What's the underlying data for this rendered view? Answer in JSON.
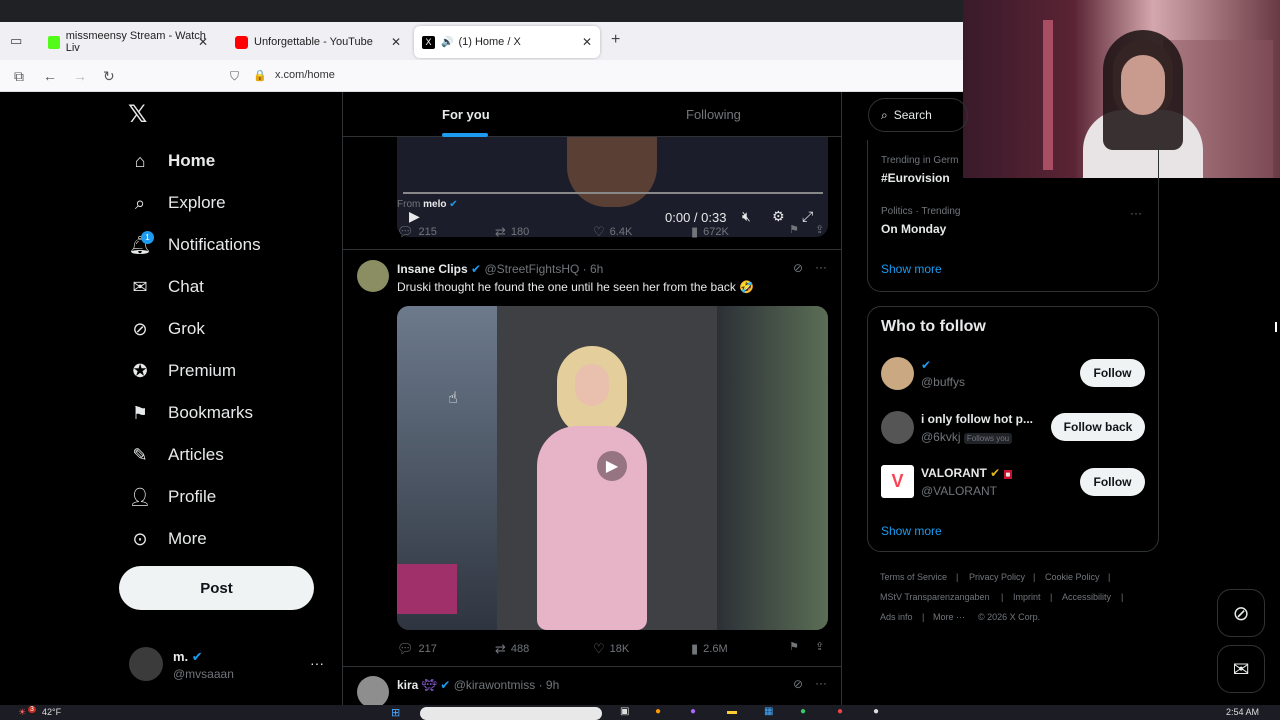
{
  "browser": {
    "tabs": [
      {
        "title": "missmeensy Stream - Watch Liv",
        "color": "#53fc18"
      },
      {
        "title": "Unforgettable - YouTube",
        "color": "#ff0000"
      },
      {
        "title": "(1) Home / X",
        "color": "#000000"
      }
    ],
    "url": "x.com/home"
  },
  "nav": {
    "items": [
      {
        "label": "Home",
        "icon": "home-icon"
      },
      {
        "label": "Explore",
        "icon": "search-icon"
      },
      {
        "label": "Notifications",
        "icon": "bell-icon",
        "badge": "1"
      },
      {
        "label": "Chat",
        "icon": "mail-icon"
      },
      {
        "label": "Grok",
        "icon": "grok-icon"
      },
      {
        "label": "Premium",
        "icon": "verified-icon"
      },
      {
        "label": "Bookmarks",
        "icon": "bookmark-icon"
      },
      {
        "label": "Articles",
        "icon": "article-icon"
      },
      {
        "label": "Profile",
        "icon": "person-icon"
      },
      {
        "label": "More",
        "icon": "more-icon"
      }
    ],
    "post_label": "Post",
    "account": {
      "name": "m.",
      "handle": "@mvsaaan"
    }
  },
  "feed": {
    "tabs": [
      "For you",
      "Following"
    ],
    "video1": {
      "time": "0:00 / 0:33",
      "from_label": "From",
      "from_name": "melo",
      "stats": {
        "replies": "215",
        "reposts": "180",
        "likes": "6.4K",
        "views": "672K"
      }
    },
    "post2": {
      "name": "Insane Clips",
      "handle": "@StreetFightsHQ",
      "age": "· 6h",
      "text": "Druski thought he found the one until he seen her from the back 🤣",
      "stats": {
        "replies": "217",
        "reposts": "488",
        "likes": "18K",
        "views": "2.6M"
      }
    },
    "post3": {
      "name": "kira",
      "handle": "@kirawontmiss",
      "age": "· 9h"
    }
  },
  "right": {
    "search_placeholder": "Search",
    "trends": [
      {
        "context": "Trending in Germ",
        "title": "#Eurovision"
      },
      {
        "context": "Politics · Trending",
        "title": "On Monday"
      }
    ],
    "show_more": "Show more",
    "who_to_follow": {
      "title": "Who to follow",
      "accounts": [
        {
          "name": "",
          "handle": "@buffys",
          "button": "Follow"
        },
        {
          "name": "i only follow hot p...",
          "handle": "@6kvkj",
          "note": "Follows you",
          "button": "Follow back"
        },
        {
          "name": "VALORANT",
          "handle": "@VALORANT",
          "button": "Follow"
        }
      ],
      "show_more": "Show more"
    },
    "footer": [
      "Terms of Service",
      "Privacy Policy",
      "Cookie Policy",
      "MStV Transparenzangaben",
      "Imprint",
      "Accessibility",
      "Ads info",
      "More ···",
      "© 2026 X Corp."
    ]
  },
  "taskbar": {
    "temp": "42°F",
    "time": "2:54 AM",
    "badge": "3"
  }
}
